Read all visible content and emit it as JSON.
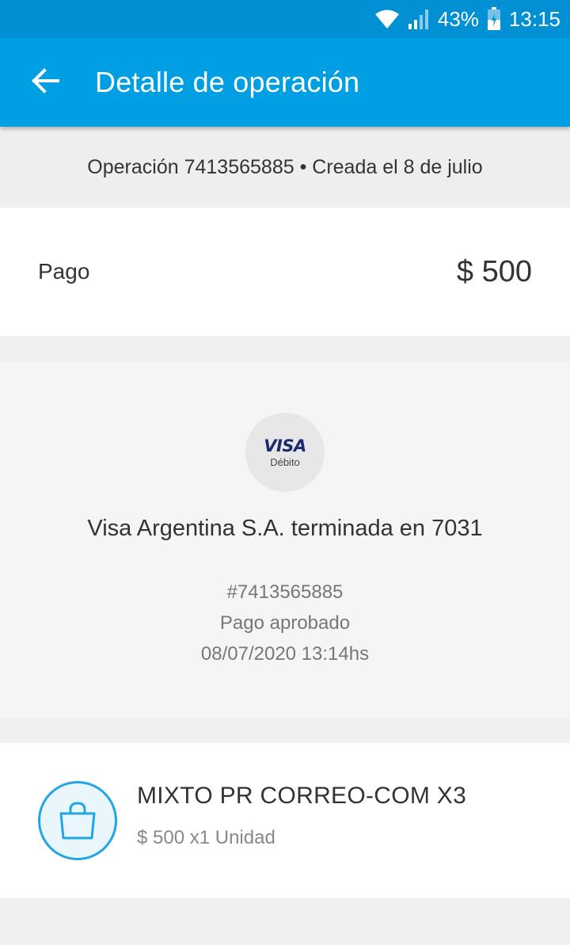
{
  "status_bar": {
    "battery": "43%",
    "time": "13:15",
    "icons": [
      "wifi-icon",
      "signal-icon",
      "battery-icon"
    ]
  },
  "app_bar": {
    "title": "Detalle de operación",
    "back_icon": "arrow-left-icon",
    "color": "#009ee3"
  },
  "operation": {
    "header": "Operación 7413565885 • Creada el 8 de julio"
  },
  "payment": {
    "label": "Pago",
    "amount": "$ 500"
  },
  "card": {
    "brand": "VISA",
    "type": "Débito",
    "name": "Visa Argentina S.A. terminada en 7031",
    "reference": "#7413565885",
    "status": "Pago aprobado",
    "datetime": "08/07/2020 13:14hs"
  },
  "item": {
    "icon": "shopping-bag-icon",
    "title": "MIXTO PR CORREO-COM X3",
    "detail": "$ 500 x1 Unidad"
  }
}
